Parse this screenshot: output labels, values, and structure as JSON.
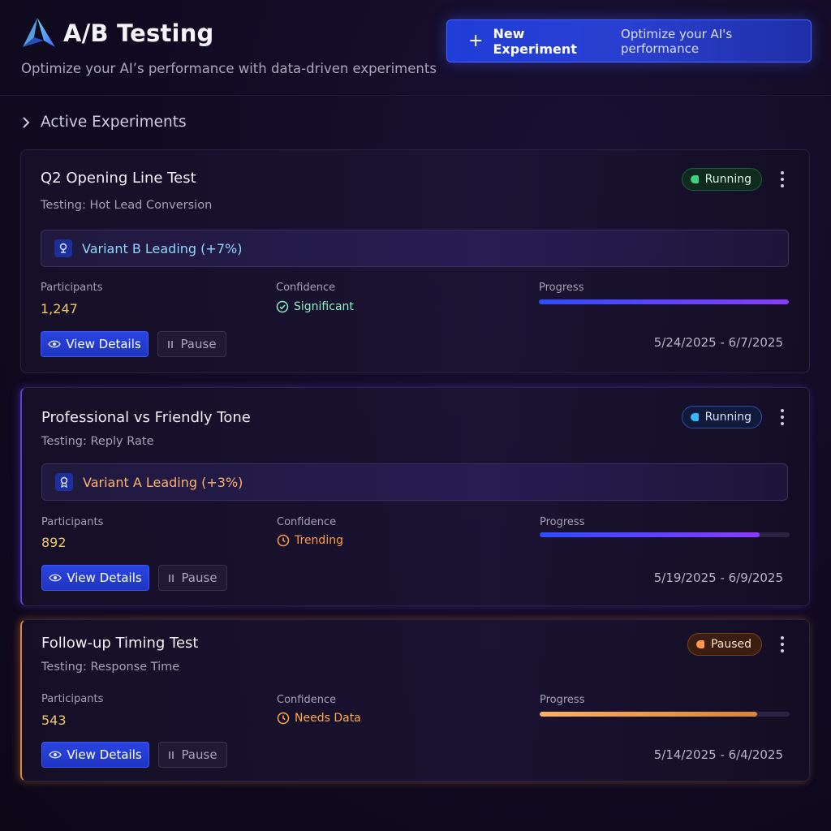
{
  "header": {
    "title": "A/B Testing",
    "subtitle": "Optimize your AI’s performance with data-driven experiments",
    "new_button_label": "New Experiment",
    "new_button_sub": "Optimize your AI's performance",
    "logo_icon": "triangle-logo-icon"
  },
  "section": {
    "title": "Active Experiments"
  },
  "labels": {
    "participants": "Participants",
    "confidence": "Confidence",
    "progress": "Progress",
    "view_details": "View Details",
    "pause": "Pause"
  },
  "experiments": [
    {
      "title": "Q2 Opening Line Test",
      "testing": "Testing: Hot Lead Conversion",
      "status": "Running",
      "status_color": "#3ed47f",
      "leader": "Variant B Leading (+7%)",
      "participants": "1,247",
      "confidence": "Significant",
      "progress": 1.0,
      "dates": "5/24/2025 - 6/7/2025"
    },
    {
      "title": "Professional vs Friendly Tone",
      "testing": "Testing: Reply Rate",
      "status": "Running",
      "status_color": "#38b6ff",
      "leader": "Variant A Leading (+3%)",
      "participants": "892",
      "confidence": "Trending",
      "progress": 0.88,
      "dates": "5/19/2025 - 6/9/2025"
    },
    {
      "title": "Follow-up Timing Test",
      "testing": "Testing: Response Time",
      "status": "Paused",
      "status_color": "#ff9a4a",
      "participants": "543",
      "confidence": "Needs Data",
      "progress": 0.87,
      "dates": "5/14/2025 - 6/4/2025"
    }
  ],
  "colors": {
    "accent": "#2a44e0",
    "progress_blue_purple": [
      "#2f4cff",
      "#8a3cff"
    ],
    "progress_orange": [
      "#ffb060",
      "#d8843a"
    ]
  }
}
